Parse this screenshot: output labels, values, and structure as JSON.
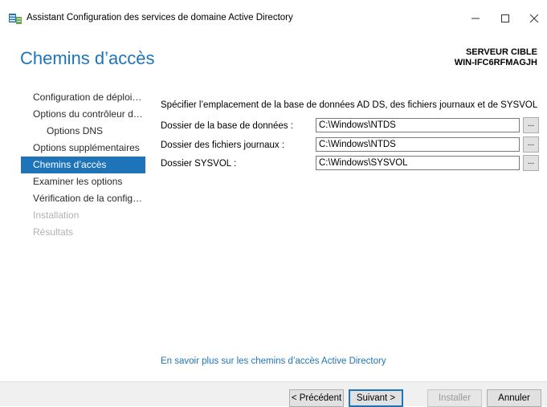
{
  "window": {
    "title": "Assistant Configuration des services de domaine Active Directory",
    "app_icon": "server-config-icon",
    "controls": {
      "minimize": "–",
      "maximize": "☐",
      "close": "✕"
    }
  },
  "header": {
    "page_title": "Chemins d’accès",
    "target_label": "SERVEUR CIBLE",
    "target_name": "WIN-IFC6RFMAGJH"
  },
  "sidebar": {
    "items": [
      {
        "label": "Configuration de déploiement"
      },
      {
        "label": "Options du contrôleur de domaine"
      },
      {
        "label": "Options DNS"
      },
      {
        "label": "Options supplémentaires"
      },
      {
        "label": "Chemins d’accès"
      },
      {
        "label": "Examiner les options"
      },
      {
        "label": "Vérification de la configuration"
      },
      {
        "label": "Installation"
      },
      {
        "label": "Résultats"
      }
    ]
  },
  "main": {
    "intro": "Spécifier l’emplacement de la base de données AD DS, des fichiers journaux et de SYSVOL",
    "fields": [
      {
        "label": "Dossier de la base de données :",
        "value": "C:\\Windows\\NTDS",
        "browse": "..."
      },
      {
        "label": "Dossier des fichiers journaux :",
        "value": "C:\\Windows\\NTDS",
        "browse": "..."
      },
      {
        "label": "Dossier SYSVOL :",
        "value": "C:\\Windows\\SYSVOL",
        "browse": "..."
      }
    ],
    "learn_more": "En savoir plus sur les chemins d’accès Active Directory"
  },
  "footer": {
    "previous": "< Précédent",
    "next": "Suivant >",
    "install": "Installer",
    "cancel": "Annuler"
  },
  "colors": {
    "accent": "#1e74b8"
  }
}
